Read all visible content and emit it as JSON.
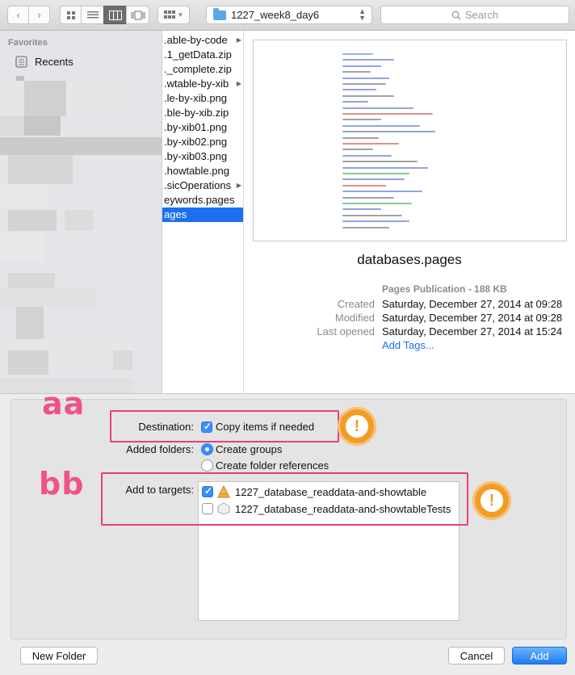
{
  "toolbar": {
    "path_label": "1227_week8_day6",
    "search_placeholder": "Search"
  },
  "sidebar": {
    "section_title": "Favorites",
    "items": [
      {
        "label": "Recents",
        "icon": "recents-icon"
      }
    ]
  },
  "files": [
    {
      "label": ".able-by-code",
      "folder": true
    },
    {
      "label": ".1_getData.zip",
      "folder": false
    },
    {
      "label": "._complete.zip",
      "folder": false
    },
    {
      "label": ".wtable-by-xib",
      "folder": true
    },
    {
      "label": ".le-by-xib.png",
      "folder": false
    },
    {
      "label": ".ble-by-xib.zip",
      "folder": false
    },
    {
      "label": ".by-xib01.png",
      "folder": false
    },
    {
      "label": ".by-xib02.png",
      "folder": false
    },
    {
      "label": ".by-xib03.png",
      "folder": false
    },
    {
      "label": ".howtable.png",
      "folder": false
    },
    {
      "label": ".sicOperations",
      "folder": true
    },
    {
      "label": "eywords.pages",
      "folder": false
    },
    {
      "label": "ages",
      "folder": false,
      "selected": true
    }
  ],
  "preview": {
    "filename": "databases.pages",
    "kind": "Pages Publication - 188 KB",
    "created_label": "Created",
    "created": "Saturday, December 27, 2014 at 09:28",
    "modified_label": "Modified",
    "modified": "Saturday, December 27, 2014 at 09:28",
    "opened_label": "Last opened",
    "opened": "Saturday, December 27, 2014 at 15:24",
    "add_tags": "Add Tags..."
  },
  "options": {
    "destination_label": "Destination:",
    "copy_label": "Copy items if needed",
    "copy_checked": true,
    "added_folders_label": "Added folders:",
    "create_groups": "Create groups",
    "create_refs": "Create folder references",
    "selected_folder_option": "Create groups",
    "targets_label": "Add to targets:",
    "targets": [
      {
        "label": "1227_database_readdata-and-showtable",
        "checked": true,
        "icon": "app-target-icon"
      },
      {
        "label": "1227_database_readdata-and-showtableTests",
        "checked": false,
        "icon": "test-target-icon"
      }
    ]
  },
  "annotations": {
    "a": "aa",
    "b": "bb"
  },
  "buttons": {
    "new_folder": "New Folder",
    "cancel": "Cancel",
    "add": "Add"
  },
  "colors": {
    "accent": "#1d6ff2",
    "annotation": "#f05288",
    "warning": "#f39c24"
  }
}
